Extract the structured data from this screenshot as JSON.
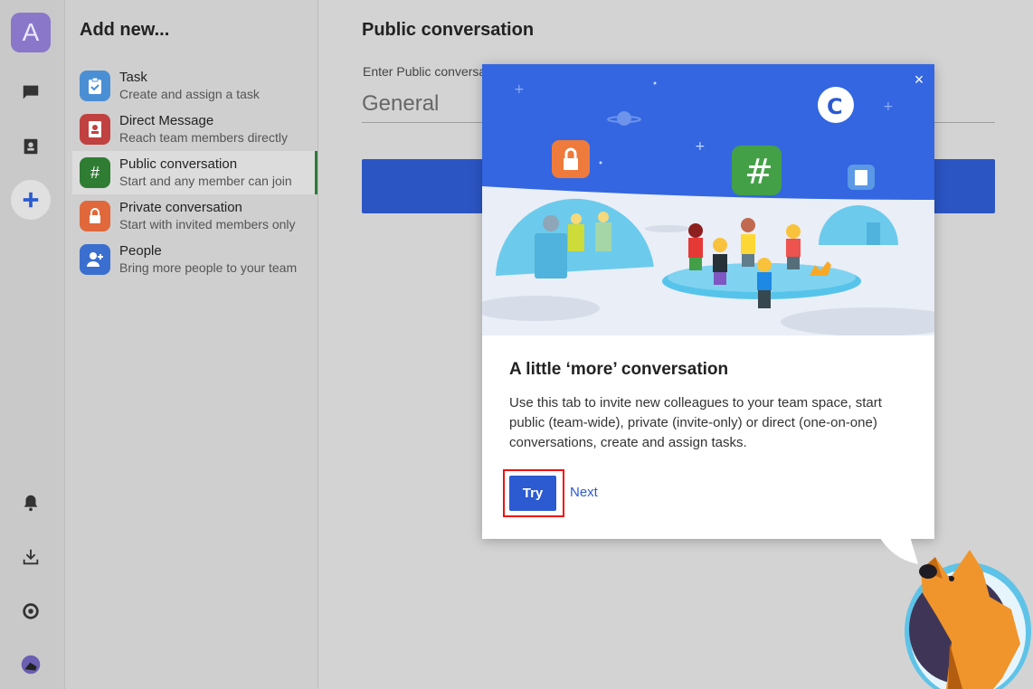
{
  "rail": {
    "workspace_initial": "A"
  },
  "add_new": {
    "title": "Add new...",
    "items": [
      {
        "title": "Task",
        "subtitle": "Create and assign a task",
        "color": "#4a8fd4",
        "icon": "clipboard-icon"
      },
      {
        "title": "Direct Message",
        "subtitle": "Reach team members directly",
        "color": "#c0413f",
        "icon": "contact-book-icon"
      },
      {
        "title": "Public conversation",
        "subtitle": "Start and any member can join",
        "color": "#2e7d32",
        "icon": "hash-icon"
      },
      {
        "title": "Private conversation",
        "subtitle": "Start with invited members only",
        "color": "#e0683a",
        "icon": "lock-icon"
      },
      {
        "title": "People",
        "subtitle": "Bring more people to your team",
        "color": "#3a6fd0",
        "icon": "add-person-icon"
      }
    ]
  },
  "main": {
    "title": "Public conversation",
    "field_label": "Enter Public conversa",
    "field_value": "General"
  },
  "modal": {
    "heading": "A little ‘more’ conversation",
    "body": "Use this tab to invite new colleagues to your team space, start public (team-wide), private (invite-only) or direct (one-on-one) conversations, create and assign tasks.",
    "try_label": "Try",
    "next_label": "Next",
    "close_glyph": "×"
  },
  "colors": {
    "accent": "#2b5ad1",
    "illustration_sky": "#3366e0"
  }
}
